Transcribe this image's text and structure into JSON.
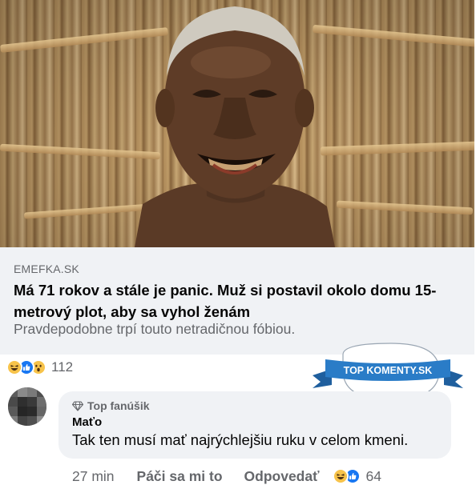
{
  "link_preview": {
    "domain": "EMEFKA.SK",
    "headline": "Má 71 rokov a stále je panic. Muž si postavil okolo domu 15-metrový plot, aby sa vyhol ženám",
    "subtitle": "Pravdepodobne trpí touto netradičnou fóbiou."
  },
  "post_reactions": {
    "icons": [
      "haha-emoji-icon",
      "like-icon",
      "wow-emoji-icon"
    ],
    "count": "112"
  },
  "badge": {
    "text": "TOP KOMENTY.SK",
    "color": "#2a7cc7"
  },
  "comment": {
    "badge_label": "Top fanúšik",
    "author": "Maťo",
    "text": "Tak ten musí mať najrýchlejšiu ruku v celom kmeni.",
    "time": "27 min",
    "like_label": "Páči sa mi to",
    "reply_label": "Odpovedať",
    "reaction_icons": [
      "haha-emoji-icon",
      "like-icon"
    ],
    "reaction_count": "64"
  },
  "colors": {
    "text": "#050505",
    "secondary": "#65676b",
    "bubble": "#f0f2f5",
    "like_blue": "#1877f2",
    "emoji_yellow": "#f7c34a"
  }
}
